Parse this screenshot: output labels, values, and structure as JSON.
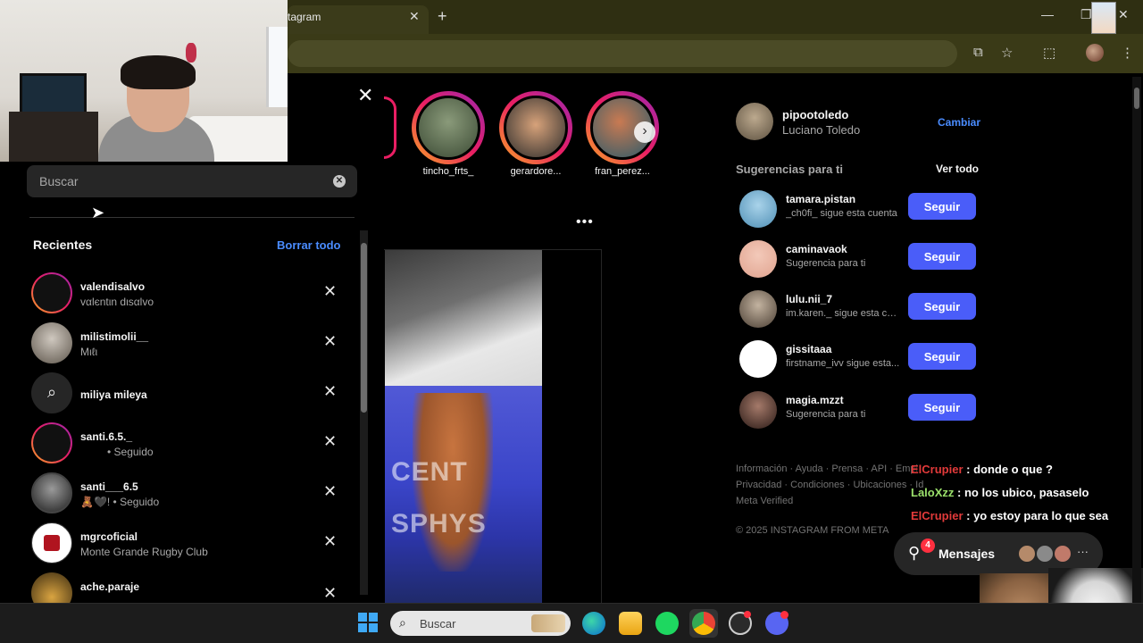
{
  "browser": {
    "tab_title": "tagram",
    "tab_close": "✕",
    "new_tab": "+",
    "minimize": "—",
    "close": "✕"
  },
  "search_panel": {
    "close_symbol": "✕",
    "placeholder": "Buscar",
    "recent_title": "Recientes",
    "clear_all": "Borrar todo",
    "items": [
      {
        "name": "valendisalvo",
        "sub": "vαlєntιn dιsαlvo"
      },
      {
        "name": "milistimolii__",
        "sub": "Mιℓι"
      },
      {
        "name": "miliya mileya",
        "sub": ""
      },
      {
        "name": "santi.6.5._",
        "sub": "• Seguido"
      },
      {
        "name": "santi___6.5",
        "sub": "🧸🖤! • Seguido"
      },
      {
        "name": "mgrcoficial",
        "sub": "Monte Grande Rugby Club"
      },
      {
        "name": "ache.paraje",
        "sub": ""
      }
    ]
  },
  "stories": [
    {
      "name": "tincho_frts_"
    },
    {
      "name": "gerardore..."
    },
    {
      "name": "fran_perez..."
    }
  ],
  "post": {
    "text": "CENT\nSPHYS"
  },
  "sidebar": {
    "username": "pipootoledo",
    "fullname": "Luciano Toledo",
    "switch": "Cambiar",
    "suggestions_title": "Sugerencias para ti",
    "see_all": "Ver todo",
    "follow_label": "Seguir",
    "suggestions": [
      {
        "user": "tamara.pistan",
        "sub": "_ch0fi_ sigue esta cuenta",
        "color": "#4f8fb5"
      },
      {
        "user": "caminavaok",
        "sub": "Sugerencia para ti",
        "color": "#e0a38f"
      },
      {
        "user": "lulu.nii_7",
        "sub": "im.karen._ sigue esta cu...",
        "color": "#8a7a6a"
      },
      {
        "user": "gissitaaa",
        "sub": "firstname_ivv sigue esta...",
        "color": "#ffffff"
      },
      {
        "user": "magia.mzzt",
        "sub": "Sugerencia para ti",
        "color": "#5a3a32"
      }
    ],
    "footer_line1": "Información · Ayuda · Prensa · API · Empl",
    "footer_line2": "Privacidad · Condiciones · Ubicaciones · Idioma",
    "footer_line3": "Meta Verified",
    "copyright": "© 2025 INSTAGRAM FROM META"
  },
  "chat": [
    {
      "user": "ElCrupier",
      "msg": " : donde o que ?",
      "color": "red"
    },
    {
      "user": "LaloXzz",
      "msg": " : no los ubico, pasaselo",
      "color": "green"
    },
    {
      "user": "ElCrupier",
      "msg": " : yo estoy para lo que sea",
      "color": "red"
    }
  ],
  "messages": {
    "label": "Mensajes",
    "badge": "4",
    "more": "···"
  },
  "taskbar": {
    "search_label": "Buscar"
  },
  "colors": {
    "accent": "#4a5df9",
    "link": "#4a8cff",
    "badge": "#ff3040"
  }
}
